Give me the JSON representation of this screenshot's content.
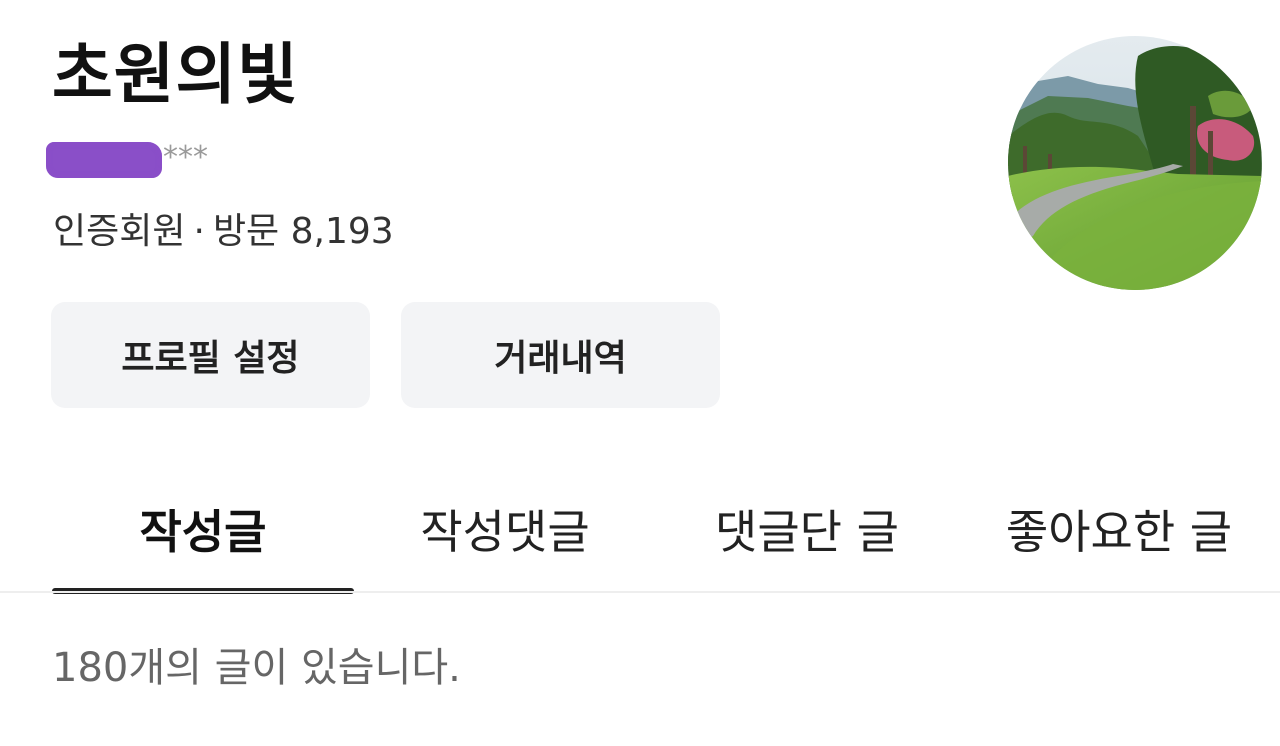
{
  "profile": {
    "nickname": "초원의빛",
    "user_id_masked": "***",
    "member_type": "인증회원",
    "separator": "·",
    "visit_label": "방문",
    "visit_count": "8,193",
    "avatar_icon": "landscape-photo-avatar"
  },
  "buttons": {
    "profile_settings": "프로필 설정",
    "transaction_history": "거래내역"
  },
  "tabs": [
    {
      "label": "작성글",
      "active": true
    },
    {
      "label": "작성댓글",
      "active": false
    },
    {
      "label": "댓글단 글",
      "active": false
    },
    {
      "label": "좋아요한 글",
      "active": false
    }
  ],
  "summary": {
    "post_count_text": "180개의 글이 있습니다."
  },
  "colors": {
    "redaction": "#8a4fc8",
    "button_bg": "#f3f4f6",
    "active_tab_underline": "#222222"
  }
}
